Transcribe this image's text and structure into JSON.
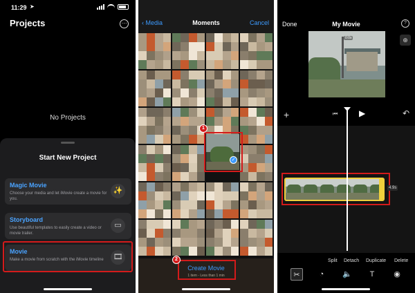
{
  "panel1": {
    "status": {
      "time": "11:29",
      "location_arrow": "➤"
    },
    "title": "Projects",
    "more_icon": "⋯",
    "empty_text": "No Projects",
    "sheet": {
      "title": "Start New Project",
      "options": [
        {
          "title": "Magic Movie",
          "desc": "Choose your media and let iMovie create a movie for you.",
          "icon": "magic-wand-icon",
          "glyph": "✨"
        },
        {
          "title": "Storyboard",
          "desc": "Use beautiful templates to easily create a video or movie trailer.",
          "icon": "storyboard-icon",
          "glyph": "▭"
        },
        {
          "title": "Movie",
          "desc": "Make a movie from scratch with the iMovie timeline",
          "icon": "film-icon",
          "glyph": "🎞"
        }
      ]
    }
  },
  "panel2": {
    "back_label": "Media",
    "back_chevron": "‹",
    "title": "Moments",
    "cancel_label": "Cancel",
    "badge1": "1",
    "badge2": "2",
    "check": "✓",
    "create_label": "Create Movie",
    "create_sub": "1 item - Less than 1 min"
  },
  "panel3": {
    "done_label": "Done",
    "title": "My Movie",
    "help": "?",
    "zoom": "⊕",
    "preview_time": "0:0s",
    "add": "+",
    "skip_back": "⏮",
    "play": "▶",
    "undo": "↶",
    "clip_duration": "4.9s",
    "actions": [
      "Split",
      "Detach",
      "Duplicate",
      "Delete"
    ],
    "tools": [
      {
        "name": "scissors-icon",
        "glyph": "✂"
      },
      {
        "name": "speed-icon",
        "glyph": "◔"
      },
      {
        "name": "volume-icon",
        "glyph": "🔈"
      },
      {
        "name": "text-icon",
        "glyph": "T"
      },
      {
        "name": "filters-icon",
        "glyph": "◉"
      }
    ]
  },
  "colors": {
    "highlight": "#d41b1b",
    "accent_blue": "#3d9bff",
    "clip_yellow": "#f0d03c"
  }
}
